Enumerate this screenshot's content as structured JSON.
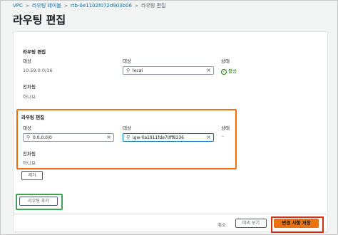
{
  "breadcrumb": {
    "items": [
      "VPC",
      "라우팅 테이블",
      "rtb-0e1102f072d903b06",
      "라우팅 편집"
    ],
    "separator": ">"
  },
  "page": {
    "title": "라우팅 편집"
  },
  "routes": [
    {
      "heading": "라우팅 편집",
      "destination_label": "대상",
      "destination_value": "10.59.0.0/16",
      "target_label": "대상",
      "target_value": "local",
      "status_label": "상태",
      "status_value": "활성",
      "propagated_label": "전파됨",
      "propagated_value": "아니요"
    },
    {
      "heading": "라우팅 편집",
      "destination_label": "대상",
      "destination_value": "0.0.0.0/0",
      "target_label": "대상",
      "target_value": "igw-0a1911fde70ff8336",
      "status_label": "상태",
      "status_value": "–",
      "propagated_label": "전파됨",
      "propagated_value": "아니요",
      "remove_label": "제거"
    }
  ],
  "add_route_label": "라우팅 추가",
  "footer": {
    "cancel_label": "취소",
    "preview_label": "미리 보기",
    "save_label": "변경 사항 저장"
  },
  "colors": {
    "orange_highlight": "#ec7211",
    "green_highlight": "#3aa652",
    "red_highlight": "#d13212",
    "link": "#0073bb",
    "status_ok": "#1d8102"
  }
}
